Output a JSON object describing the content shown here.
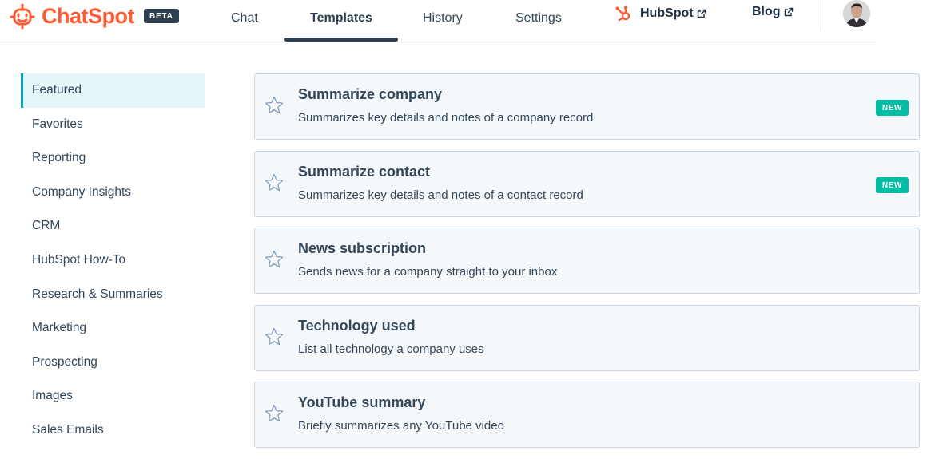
{
  "header": {
    "logo_text": "ChatSpot",
    "beta_label": "BETA",
    "tabs": [
      {
        "label": "Chat"
      },
      {
        "label": "Templates"
      },
      {
        "label": "History"
      },
      {
        "label": "Settings"
      }
    ],
    "active_tab": "Templates",
    "links": [
      {
        "label": "HubSpot",
        "icon": "external-link-icon"
      },
      {
        "label": "Blog",
        "icon": "external-link-icon"
      }
    ]
  },
  "sidebar": {
    "items": [
      {
        "label": "Featured"
      },
      {
        "label": "Favorites"
      },
      {
        "label": "Reporting"
      },
      {
        "label": "Company Insights"
      },
      {
        "label": "CRM"
      },
      {
        "label": "HubSpot How-To"
      },
      {
        "label": "Research & Summaries"
      },
      {
        "label": "Marketing"
      },
      {
        "label": "Prospecting"
      },
      {
        "label": "Images"
      },
      {
        "label": "Sales Emails"
      }
    ],
    "active": "Featured"
  },
  "templates": [
    {
      "title": "Summarize company",
      "description": "Summarizes key details and notes of a company record",
      "badge": "NEW"
    },
    {
      "title": "Summarize contact",
      "description": "Summarizes key details and notes of a contact record",
      "badge": "NEW"
    },
    {
      "title": "News subscription",
      "description": "Sends news for a company straight to your inbox",
      "badge": ""
    },
    {
      "title": "Technology used",
      "description": "List all technology a company uses",
      "badge": ""
    },
    {
      "title": "YouTube summary",
      "description": "Briefly summarizes any YouTube video",
      "badge": ""
    }
  ],
  "colors": {
    "brand": "#ff5c35",
    "active_accent": "#00a4bd",
    "new_badge": "#00bda5",
    "card_bg": "#f5f8fa"
  }
}
